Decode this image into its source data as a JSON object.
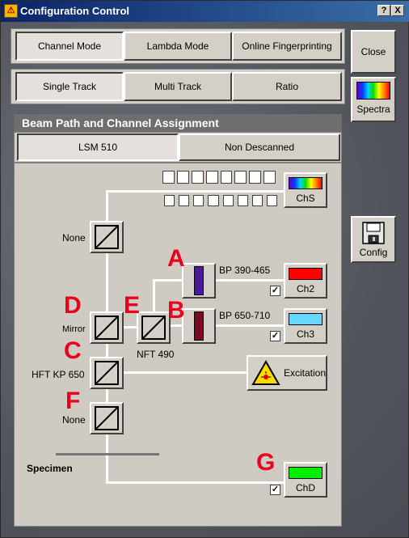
{
  "window": {
    "title": "Configuration Control",
    "help_button": "?",
    "close_button": "X"
  },
  "mode_tabs": [
    "Channel Mode",
    "Lambda Mode",
    "Online Fingerprinting"
  ],
  "track_tabs": [
    "Single Track",
    "Multi Track",
    "Ratio"
  ],
  "side_buttons": {
    "close": "Close",
    "spectra": "Spectra",
    "config": "Config"
  },
  "beam_panel": {
    "title": "Beam Path and Channel Assignment",
    "tabs": [
      "LSM 510",
      "Non Descanned"
    ]
  },
  "diagram": {
    "beamsplitter_labels": {
      "top": "None",
      "mirror": "Mirror",
      "hft": "HFT KP 650",
      "bottom": "None",
      "nft": "NFT 490"
    },
    "filters": {
      "a": "BP 390-465",
      "b": "BP 650-710"
    },
    "channels": {
      "chs": "ChS",
      "ch2": "Ch2",
      "ch3": "Ch3",
      "chd": "ChD"
    },
    "excitation_label": "Excitation",
    "specimen_label": "Specimen",
    "annotation_letters": {
      "a": "A",
      "b": "B",
      "c": "C",
      "d": "D",
      "e": "E",
      "f": "F",
      "g": "G"
    },
    "checkbox_mark": "✓"
  },
  "colors": {
    "ch2": "#ff0000",
    "ch3": "#66d8ff",
    "chd": "#00ee00",
    "filter_a": "#4b1a9c",
    "filter_b": "#7a0a2c",
    "annotation": "#e8001c"
  },
  "icons": [
    "spectrum-icon",
    "floppy-disk-icon",
    "laser-warning-icon",
    "beamsplitter-icon"
  ]
}
